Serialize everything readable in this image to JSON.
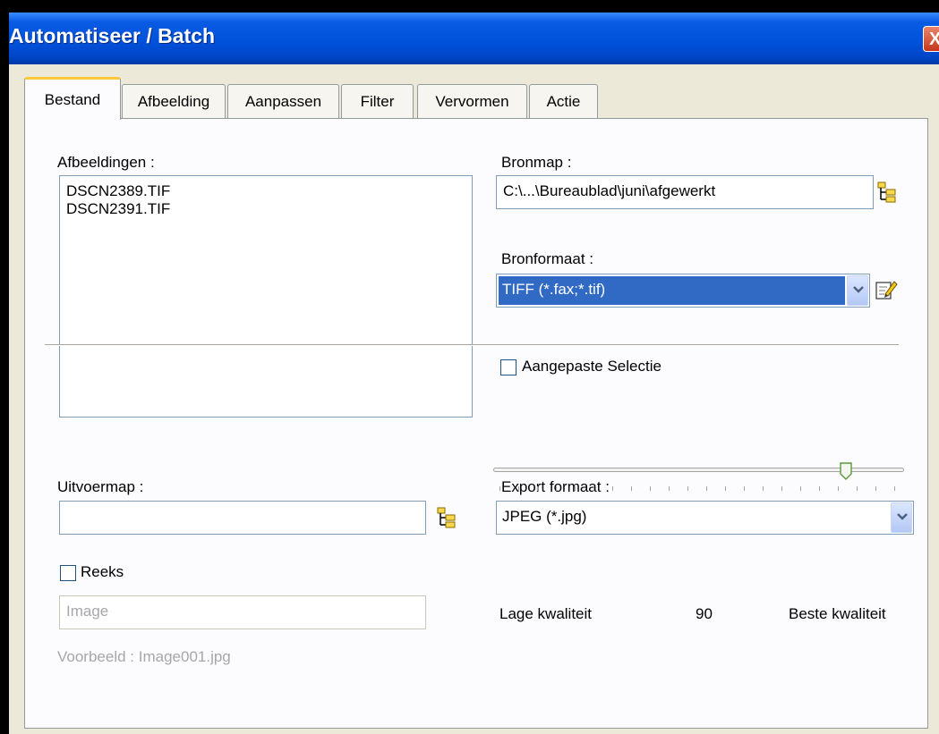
{
  "window": {
    "title": "Automatiseer / Batch",
    "close_glyph": "X"
  },
  "tabs": [
    {
      "label": "Bestand",
      "active": true
    },
    {
      "label": "Afbeelding",
      "active": false
    },
    {
      "label": "Aanpassen",
      "active": false
    },
    {
      "label": "Filter",
      "active": false
    },
    {
      "label": "Vervormen",
      "active": false
    },
    {
      "label": "Actie",
      "active": false
    }
  ],
  "images": {
    "label": "Afbeeldingen :",
    "files": [
      "DSCN2389.TIF",
      "DSCN2391.TIF"
    ]
  },
  "source": {
    "folder_label": "Bronmap :",
    "folder_value": "C:\\...\\Bureaublad\\juni\\afgewerkt",
    "format_label": "Bronformaat :",
    "format_value": "TIFF (*.fax;*.tif)",
    "custom_selection_label": "Aangepaste Selectie",
    "custom_selection_checked": false
  },
  "output": {
    "folder_label": "Uitvoermap :",
    "folder_value": "",
    "sequence_label": "Reeks",
    "sequence_checked": false,
    "name_value": "Image",
    "preview_text": "Voorbeeld : Image001.jpg"
  },
  "export": {
    "format_label": "Export formaat :",
    "format_value": "JPEG (*.jpg)",
    "quality_low_label": "Lage kwaliteit",
    "quality_value": "90",
    "quality_high_label": "Beste kwaliteit"
  },
  "colors": {
    "title_bar": "#0052dc",
    "selection": "#316ac5",
    "active_tab_accent": "#ffc83c",
    "dialog_bg": "#ece9d8"
  },
  "icons": [
    "close-icon",
    "folder-tree-icon",
    "edit-icon",
    "chevron-down-icon",
    "slider-thumb-icon"
  ]
}
